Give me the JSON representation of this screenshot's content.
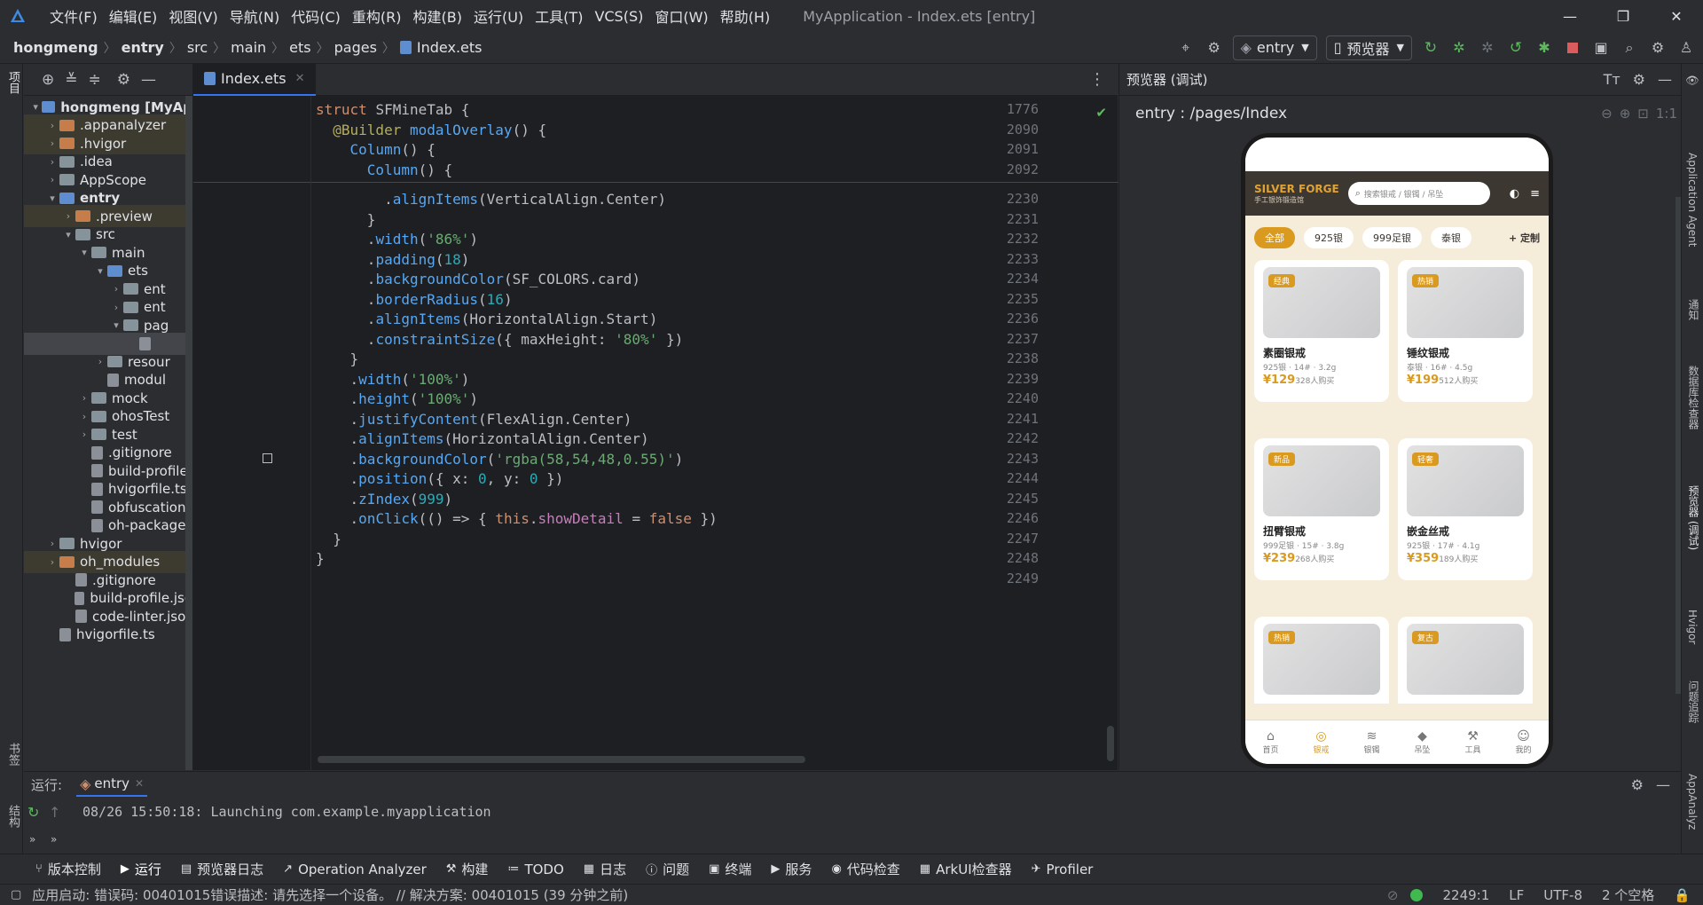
{
  "app": {
    "title": "MyApplication - Index.ets [entry]",
    "menu": [
      "文件(F)",
      "编辑(E)",
      "视图(V)",
      "导航(N)",
      "代码(C)",
      "重构(R)",
      "构建(B)",
      "运行(U)",
      "工具(T)",
      "VCS(S)",
      "窗口(W)",
      "帮助(H)"
    ]
  },
  "breadcrumb": [
    "hongmeng",
    "entry",
    "src",
    "main",
    "ets",
    "pages",
    "Index.ets"
  ],
  "toolbar": {
    "config": "entry",
    "device": "预览器"
  },
  "left_strip": {
    "top": "项目",
    "bottom1": "书签",
    "bottom2": "结构"
  },
  "project": {
    "items": [
      {
        "label": "hongmeng [MyAp",
        "depth": 0,
        "arrow": "v",
        "icon": "b",
        "bold": true
      },
      {
        "label": ".appanalyzer",
        "depth": 1,
        "arrow": ">",
        "icon": "o",
        "ex": true
      },
      {
        "label": ".hvigor",
        "depth": 1,
        "arrow": ">",
        "icon": "o",
        "ex": true
      },
      {
        "label": ".idea",
        "depth": 1,
        "arrow": ">",
        "icon": "g"
      },
      {
        "label": "AppScope",
        "depth": 1,
        "arrow": ">",
        "icon": "g"
      },
      {
        "label": "entry",
        "depth": 1,
        "arrow": "v",
        "icon": "b",
        "bold": true
      },
      {
        "label": ".preview",
        "depth": 2,
        "arrow": ">",
        "icon": "o",
        "ex": true
      },
      {
        "label": "src",
        "depth": 2,
        "arrow": "v",
        "icon": "g"
      },
      {
        "label": "main",
        "depth": 3,
        "arrow": "v",
        "icon": "g"
      },
      {
        "label": "ets",
        "depth": 4,
        "arrow": "v",
        "icon": "b"
      },
      {
        "label": "ent",
        "depth": 5,
        "arrow": ">",
        "icon": "g"
      },
      {
        "label": "ent",
        "depth": 5,
        "arrow": ">",
        "icon": "g"
      },
      {
        "label": "pag",
        "depth": 5,
        "arrow": "v",
        "icon": "g"
      },
      {
        "label": "",
        "depth": 6,
        "arrow": "",
        "icon": "f",
        "sel": true
      },
      {
        "label": "resour",
        "depth": 4,
        "arrow": ">",
        "icon": "g"
      },
      {
        "label": "modul",
        "depth": 4,
        "arrow": "",
        "icon": "f"
      },
      {
        "label": "mock",
        "depth": 3,
        "arrow": ">",
        "icon": "g"
      },
      {
        "label": "ohosTest",
        "depth": 3,
        "arrow": ">",
        "icon": "g"
      },
      {
        "label": "test",
        "depth": 3,
        "arrow": ">",
        "icon": "g"
      },
      {
        "label": ".gitignore",
        "depth": 3,
        "arrow": "",
        "icon": "f"
      },
      {
        "label": "build-profile",
        "depth": 3,
        "arrow": "",
        "icon": "f"
      },
      {
        "label": "hvigorfile.ts",
        "depth": 3,
        "arrow": "",
        "icon": "f"
      },
      {
        "label": "obfuscation-",
        "depth": 3,
        "arrow": "",
        "icon": "f"
      },
      {
        "label": "oh-package.",
        "depth": 3,
        "arrow": "",
        "icon": "f"
      },
      {
        "label": "hvigor",
        "depth": 1,
        "arrow": ">",
        "icon": "g"
      },
      {
        "label": "oh_modules",
        "depth": 1,
        "arrow": ">",
        "icon": "o",
        "ex": true
      },
      {
        "label": ".gitignore",
        "depth": 2,
        "arrow": "",
        "icon": "f"
      },
      {
        "label": "build-profile.jso",
        "depth": 2,
        "arrow": "",
        "icon": "f"
      },
      {
        "label": "code-linter.jsor",
        "depth": 2,
        "arrow": "",
        "icon": "f"
      },
      {
        "label": "hvigorfile.ts",
        "depth": 1,
        "arrow": "",
        "icon": "f"
      }
    ]
  },
  "editor": {
    "tab": "Index.ets",
    "sticky": [
      {
        "ln": "1776",
        "html": "<span class='kw'>struct</span> <span class='ty'>SFMineTab</span> {"
      },
      {
        "ln": "2090",
        "html": "  <span class='an'>@Builder</span> <span class='fn'>modalOverlay</span>() {"
      },
      {
        "ln": "2091",
        "html": "    <span class='fn'>Column</span>() {"
      },
      {
        "ln": "2092",
        "html": "      <span class='fn'>Column</span>() {"
      }
    ],
    "lines": [
      {
        "ln": "2230",
        "html": "        .<span class='fn'>alignItems</span>(VerticalAlign.Center)"
      },
      {
        "ln": "2231",
        "html": "      }"
      },
      {
        "ln": "2232",
        "html": "      .<span class='fn'>width</span>(<span class='st'>'86%'</span>)"
      },
      {
        "ln": "2233",
        "html": "      .<span class='fn'>padding</span>(<span class='nm'>18</span>)"
      },
      {
        "ln": "2234",
        "html": "      .<span class='fn'>backgroundColor</span>(SF_COLORS.card)"
      },
      {
        "ln": "2235",
        "html": "      .<span class='fn'>borderRadius</span>(<span class='nm'>16</span>)"
      },
      {
        "ln": "2236",
        "html": "      .<span class='fn'>alignItems</span>(HorizontalAlign.Start)"
      },
      {
        "ln": "2237",
        "html": "      .<span class='fn'>constraintSize</span>({ maxHeight: <span class='st'>'80%'</span> })"
      },
      {
        "ln": "2238",
        "html": "    }"
      },
      {
        "ln": "2239",
        "html": "    .<span class='fn'>width</span>(<span class='st'>'100%'</span>)"
      },
      {
        "ln": "2240",
        "html": "    .<span class='fn'>height</span>(<span class='st'>'100%'</span>)"
      },
      {
        "ln": "2241",
        "html": "    .<span class='fn'>justifyContent</span>(FlexAlign.Center)"
      },
      {
        "ln": "2242",
        "html": "    .<span class='fn'>alignItems</span>(HorizontalAlign.Center)"
      },
      {
        "ln": "2243",
        "html": "    .<span class='fn'>backgroundColor</span>(<span class='st'>'rgba(58,54,48,0.55)'</span>)"
      },
      {
        "ln": "2244",
        "html": "    .<span class='fn'>position</span>({ x: <span class='nm'>0</span>, y: <span class='nm'>0</span> })"
      },
      {
        "ln": "2245",
        "html": "    .<span class='fn'>zIndex</span>(<span class='nm'>999</span>)"
      },
      {
        "ln": "2246",
        "html": "    .<span class='fn'>onClick</span>(() => { <span class='kw'>this</span>.<span class='pr'>showDetail</span> = <span class='kw'>false</span> })"
      },
      {
        "ln": "2247",
        "html": "  }"
      },
      {
        "ln": "2248",
        "html": "}"
      },
      {
        "ln": "2249",
        "html": ""
      }
    ]
  },
  "preview": {
    "header": "预览器 (调试)",
    "path": "entry : /pages/Index",
    "zoom": "1:1",
    "brand": "SILVER FORGE",
    "brand_sub": "手工银饰锻造馆",
    "search_placeholder": "搜索银戒 / 银镯 / 吊坠",
    "chips": [
      "全部",
      "925银",
      "999足银",
      "泰银"
    ],
    "custom": "+ 定制",
    "cards": [
      {
        "tag": "经典",
        "name": "素圈银戒",
        "sub": "925银 · 14# · 3.2g",
        "price": "¥129",
        "sold": "328人购买"
      },
      {
        "tag": "热销",
        "name": "锤纹银戒",
        "sub": "泰银 · 16# · 4.5g",
        "price": "¥199",
        "sold": "512人购买"
      },
      {
        "tag": "新品",
        "name": "扭臂银戒",
        "sub": "999足银 · 15# · 3.8g",
        "price": "¥239",
        "sold": "268人购买"
      },
      {
        "tag": "轻奢",
        "name": "嵌金丝戒",
        "sub": "925银 · 17# · 4.1g",
        "price": "¥359",
        "sold": "189人购买"
      },
      {
        "tag": "热销",
        "name": "",
        "sub": "",
        "price": "",
        "sold": ""
      },
      {
        "tag": "复古",
        "name": "",
        "sub": "",
        "price": "",
        "sold": ""
      }
    ],
    "nav": [
      {
        "icon": "⌂",
        "label": "首页"
      },
      {
        "icon": "◎",
        "label": "银戒",
        "on": true
      },
      {
        "icon": "≋",
        "label": "银镯"
      },
      {
        "icon": "◆",
        "label": "吊坠"
      },
      {
        "icon": "⚒",
        "label": "工具"
      },
      {
        "icon": "☺",
        "label": "我的"
      }
    ]
  },
  "right_strip": [
    "Application Agent",
    "通知",
    "数据库检查器",
    "预览器 (调试)",
    "Hvigor",
    "问题追踪",
    "AppAnalyz"
  ],
  "run": {
    "label": "运行:",
    "tab": "entry",
    "log": "08/26 15:50:18: Launching com.example.myapplication"
  },
  "tool_windows": [
    "版本控制",
    "运行",
    "预览器日志",
    "Operation Analyzer",
    "构建",
    "TODO",
    "日志",
    "问题",
    "终端",
    "服务",
    "代码检查",
    "ArkUI检查器",
    "Profiler"
  ],
  "status": {
    "message": "应用启动: 错误码: 00401015错误描述: 请先选择一个设备。 // 解决方案: 00401015 (39 分钟之前)",
    "position": "2249:1",
    "eol": "LF",
    "encoding": "UTF-8",
    "indent": "2 个空格"
  },
  "colors": {
    "accent": "#d99a1f",
    "phone_bg": "#f5ecd9",
    "phone_header": "#3d3731",
    "ide_bg": "#2b2d30",
    "editor_bg": "#1e1f22"
  }
}
